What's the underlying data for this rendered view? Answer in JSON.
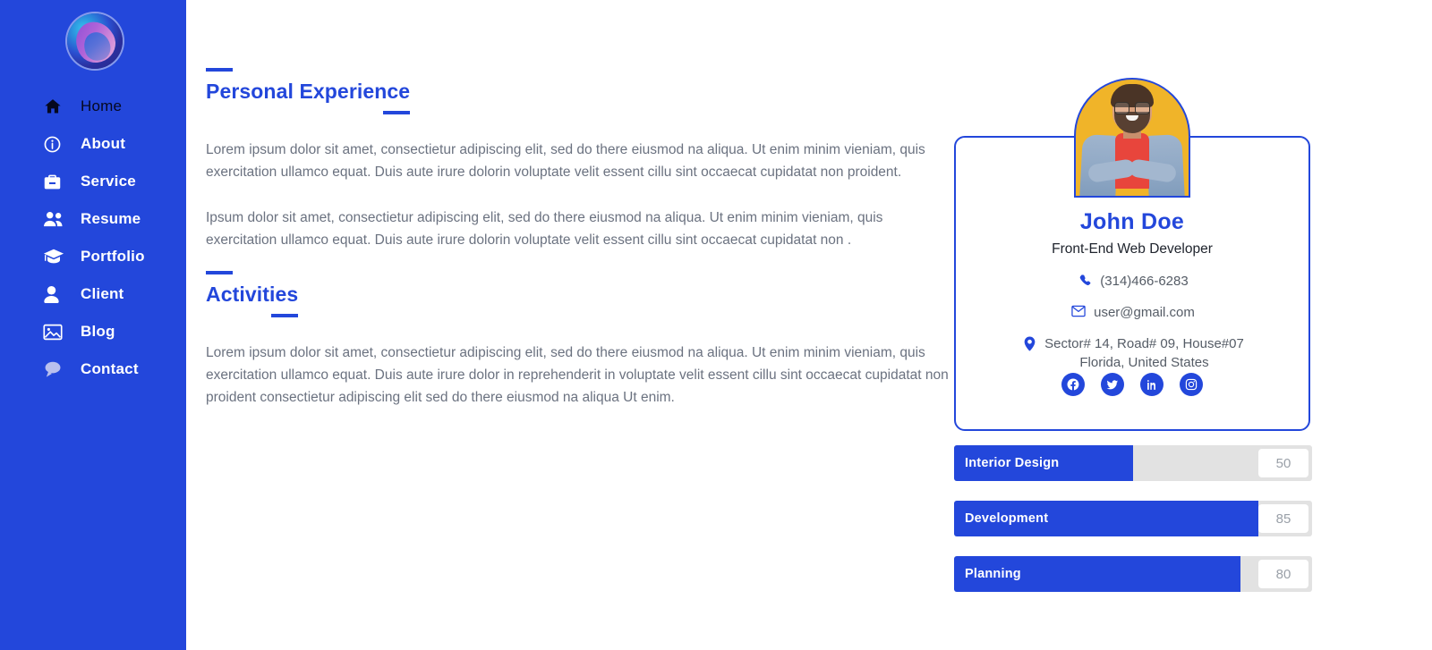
{
  "sidebar": {
    "logo_name": "app-logo-swirl",
    "collapse_label": "«",
    "items": [
      {
        "label": "Home",
        "icon": "home-icon",
        "active": true
      },
      {
        "label": "About",
        "icon": "info-icon",
        "active": false
      },
      {
        "label": "Service",
        "icon": "briefcase-icon",
        "active": false
      },
      {
        "label": "Resume",
        "icon": "users-icon",
        "active": false
      },
      {
        "label": "Portfolio",
        "icon": "graduation-cap-icon",
        "active": false
      },
      {
        "label": "Client",
        "icon": "person-icon",
        "active": false
      },
      {
        "label": "Blog",
        "icon": "image-icon",
        "active": false
      },
      {
        "label": "Contact",
        "icon": "chat-bubble-icon",
        "active": false
      }
    ]
  },
  "main": {
    "sections": [
      {
        "title": "Personal Experience",
        "paragraphs": [
          "Lorem ipsum dolor sit amet, consectietur adipiscing elit, sed do there eiusmod na aliqua. Ut enim minim vieniam, quis exercitation ullamco equat. Duis aute irure dolorin voluptate velit essent cillu sint occaecat cupidatat non proident.",
          "Ipsum dolor sit amet, consectietur adipiscing elit, sed do there eiusmod na aliqua. Ut enim minim vieniam, quis exercitation ullamco equat. Duis aute irure dolorin voluptate velit essent cillu sint occaecat cupidatat non ."
        ]
      },
      {
        "title": "Activities",
        "paragraphs": [
          "Lorem ipsum dolor sit amet, consectietur adipiscing elit, sed do there eiusmod na aliqua. Ut enim minim vieniam, quis exercitation ullamco equat. Duis aute irure dolor in reprehenderit in voluptate velit essent cillu sint occaecat cupidatat non proident consectietur adipiscing elit sed do there eiusmod na aliqua Ut enim."
        ]
      }
    ]
  },
  "profile": {
    "avatar_alt": "profile-photo",
    "name": "John Doe",
    "role": "Front-End Web Developer",
    "contacts": [
      {
        "icon": "phone-icon",
        "text": "(314)466-6283"
      },
      {
        "icon": "envelope-icon",
        "text": "user@gmail.com"
      },
      {
        "icon": "location-pin-icon",
        "text": "Sector# 14, Road# 09, House#07",
        "text2": "Florida, United States"
      }
    ],
    "socials": [
      {
        "icon": "facebook-icon",
        "label": "Facebook"
      },
      {
        "icon": "twitter-icon",
        "label": "Twitter"
      },
      {
        "icon": "linkedin-icon",
        "label": "LinkedIn"
      },
      {
        "icon": "instagram-icon",
        "label": "Instagram"
      }
    ]
  },
  "skills": [
    {
      "name": "Interior Design",
      "value": "50",
      "percent": 50
    },
    {
      "name": "Development",
      "value": "85",
      "percent": 85
    },
    {
      "name": "Planning",
      "value": "80",
      "percent": 80
    }
  ],
  "colors": {
    "brand_blue": "#2347db",
    "avatar_bg": "#f0b429",
    "track_gray": "#e2e2e2",
    "body_text": "#6b7280"
  }
}
